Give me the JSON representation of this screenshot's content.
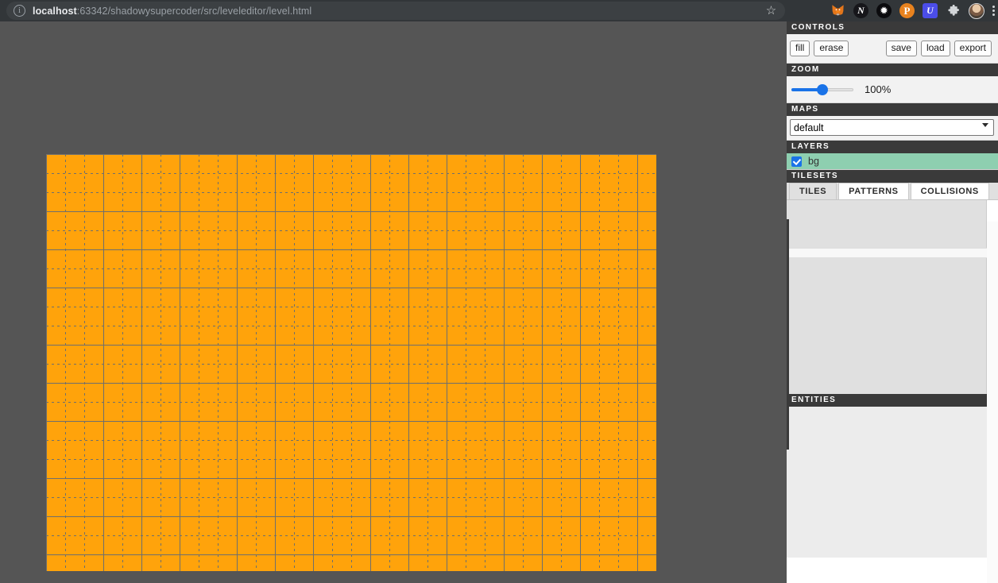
{
  "browser": {
    "url_host": "localhost",
    "url_path": ":63342/shadowysupercoder/src/leveleditor/level.html",
    "info_icon": "ⓘ",
    "star_icon": "☆",
    "extensions": [
      {
        "name": "metamask-extension-icon",
        "glyph": ""
      },
      {
        "name": "n-extension-icon",
        "glyph": "N"
      },
      {
        "name": "black-extension-icon",
        "glyph": "✹"
      },
      {
        "name": "p-extension-icon",
        "glyph": "P"
      },
      {
        "name": "u-extension-icon",
        "glyph": "U"
      },
      {
        "name": "puzzle-extensions-icon",
        "glyph": "🧩"
      }
    ],
    "puzzle_glyph": "✛",
    "menu_glyph": "⋮"
  },
  "panel": {
    "controls": {
      "header": "CONTROLS",
      "left_buttons": [
        {
          "name": "fill-button",
          "label": "fill"
        },
        {
          "name": "erase-button",
          "label": "erase"
        }
      ],
      "right_buttons": [
        {
          "name": "save-button",
          "label": "save"
        },
        {
          "name": "load-button",
          "label": "load"
        },
        {
          "name": "export-button",
          "label": "export"
        }
      ]
    },
    "zoom": {
      "header": "ZOOM",
      "value": "100%",
      "slider_percent": 50,
      "accent_color": "#1a73e8"
    },
    "maps": {
      "header": "MAPS",
      "selected": "default"
    },
    "layers": {
      "header": "LAYERS",
      "items": [
        {
          "name": "layer-bg",
          "label": "bg",
          "checked": true,
          "highlight_color": "#8ecfb0"
        }
      ]
    },
    "tilesets": {
      "header": "TILESETS",
      "tabs": [
        {
          "name": "tab-tiles",
          "label": "TILES",
          "active": true
        },
        {
          "name": "tab-patterns",
          "label": "PATTERNS",
          "active": false
        },
        {
          "name": "tab-collisions",
          "label": "COLLISIONS",
          "active": false
        }
      ]
    },
    "entities": {
      "header": "ENTITIES"
    }
  },
  "canvas": {
    "background_color": "#555555",
    "tile_fill_color": "#FFA30B",
    "grid_line_color": "#6e6e6e",
    "tile_size_px": 24,
    "columns": 32,
    "rows": 22
  }
}
